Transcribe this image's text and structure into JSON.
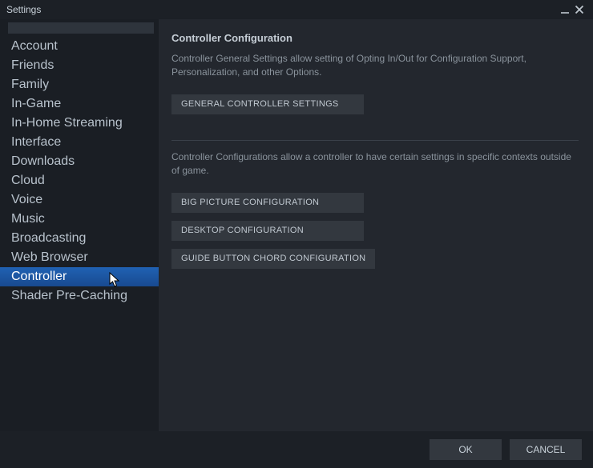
{
  "window": {
    "title": "Settings"
  },
  "sidebar": {
    "items": [
      {
        "label": "Account"
      },
      {
        "label": "Friends"
      },
      {
        "label": "Family"
      },
      {
        "label": "In-Game"
      },
      {
        "label": "In-Home Streaming"
      },
      {
        "label": "Interface"
      },
      {
        "label": "Downloads"
      },
      {
        "label": "Cloud"
      },
      {
        "label": "Voice"
      },
      {
        "label": "Music"
      },
      {
        "label": "Broadcasting"
      },
      {
        "label": "Web Browser"
      },
      {
        "label": "Controller"
      },
      {
        "label": "Shader Pre-Caching"
      }
    ],
    "selected_index": 12
  },
  "content": {
    "heading": "Controller Configuration",
    "general_desc": "Controller General Settings allow setting of Opting In/Out for Configuration Support, Personalization, and other Options.",
    "general_button": "GENERAL CONTROLLER SETTINGS",
    "context_desc": "Controller Configurations allow a controller to have certain settings in specific contexts outside of game.",
    "big_picture_button": "BIG PICTURE CONFIGURATION",
    "desktop_button": "DESKTOP CONFIGURATION",
    "guide_button": "GUIDE BUTTON CHORD CONFIGURATION"
  },
  "footer": {
    "ok": "OK",
    "cancel": "CANCEL"
  }
}
